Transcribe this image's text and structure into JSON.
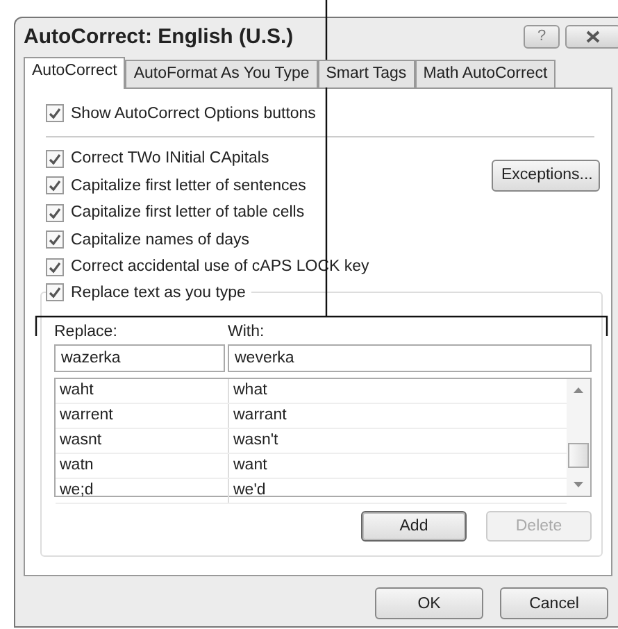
{
  "window": {
    "title": "AutoCorrect: English (U.S.)",
    "help": "?"
  },
  "tabs": [
    {
      "label": "AutoCorrect",
      "selected": true
    },
    {
      "label": "AutoFormat As You Type",
      "selected": false
    },
    {
      "label": "Smart Tags",
      "selected": false
    },
    {
      "label": "Math AutoCorrect",
      "selected": false
    }
  ],
  "show_options": {
    "label": "Show AutoCorrect Options buttons",
    "checked": true
  },
  "options": [
    {
      "label": "Correct TWo INitial CApitals",
      "checked": true
    },
    {
      "label": "Capitalize first letter of sentences",
      "checked": true
    },
    {
      "label": "Capitalize first letter of table cells",
      "checked": true
    },
    {
      "label": "Capitalize names of days",
      "checked": true
    },
    {
      "label": "Correct accidental use of cAPS LOCK key",
      "checked": true
    }
  ],
  "exceptions_button": "Exceptions...",
  "replace_group": {
    "label": "Replace text as you type",
    "checked": true,
    "replace_label": "Replace:",
    "with_label": "With:",
    "replace_value": "wazerka",
    "with_value": "weverka",
    "rows": [
      {
        "replace": "waht",
        "with": "what"
      },
      {
        "replace": "warrent",
        "with": "warrant"
      },
      {
        "replace": "wasnt",
        "with": "wasn't"
      },
      {
        "replace": "watn",
        "with": "want"
      },
      {
        "replace": "we;d",
        "with": "we'd"
      }
    ],
    "buttons": [
      {
        "label": "Add",
        "disabled": false
      },
      {
        "label": "Delete",
        "disabled": true
      }
    ]
  },
  "footer_buttons": [
    "OK",
    "Cancel"
  ]
}
